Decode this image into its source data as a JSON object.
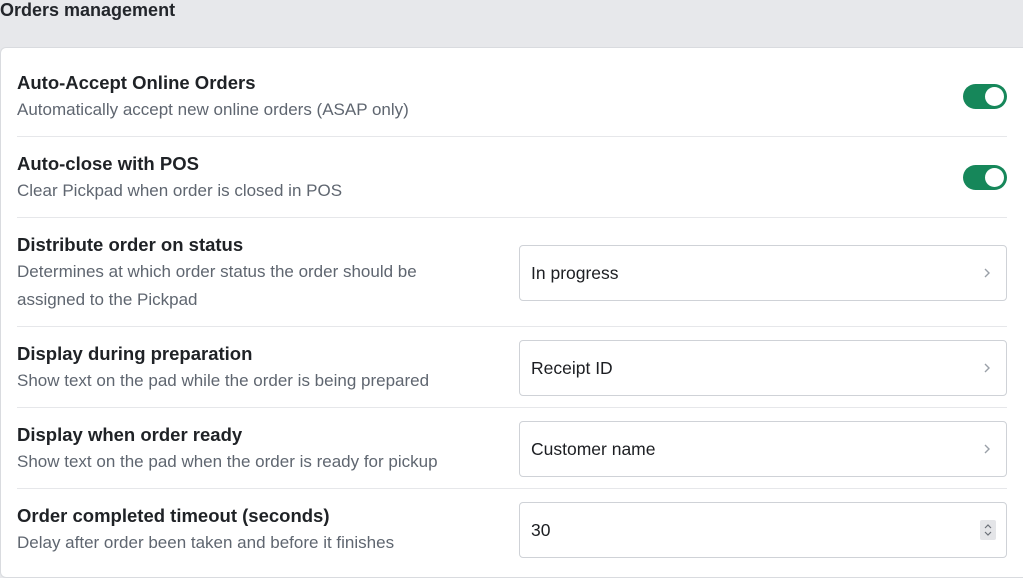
{
  "section": {
    "title": "Orders management"
  },
  "settings": [
    {
      "title": "Auto-Accept Online Orders",
      "description": "Automatically accept new online orders (ASAP only)",
      "control": "toggle",
      "enabled": true
    },
    {
      "title": "Auto-close with POS",
      "description": "Clear Pickpad when order is closed in POS",
      "control": "toggle",
      "enabled": true
    },
    {
      "title": "Distribute order on status",
      "description": "Determines at which order status the order should be assigned to the Pickpad",
      "control": "select",
      "value": "In progress"
    },
    {
      "title": "Display during preparation",
      "description": "Show text on the pad while the order is being prepared",
      "control": "select",
      "value": "Receipt ID"
    },
    {
      "title": "Display when order ready",
      "description": "Show text on the pad when the order is ready for pickup",
      "control": "select",
      "value": "Customer name"
    },
    {
      "title": "Order completed timeout (seconds)",
      "description": "Delay after order been taken and before it finishes",
      "control": "number",
      "value": "30"
    }
  ],
  "icons": {
    "select_chevron": "chevron-right-icon",
    "number_stepper": "spinner-arrows-icon"
  },
  "colors": {
    "toggle_on": "#16875a",
    "page_background": "#e7e8eb",
    "card_background": "#ffffff"
  }
}
